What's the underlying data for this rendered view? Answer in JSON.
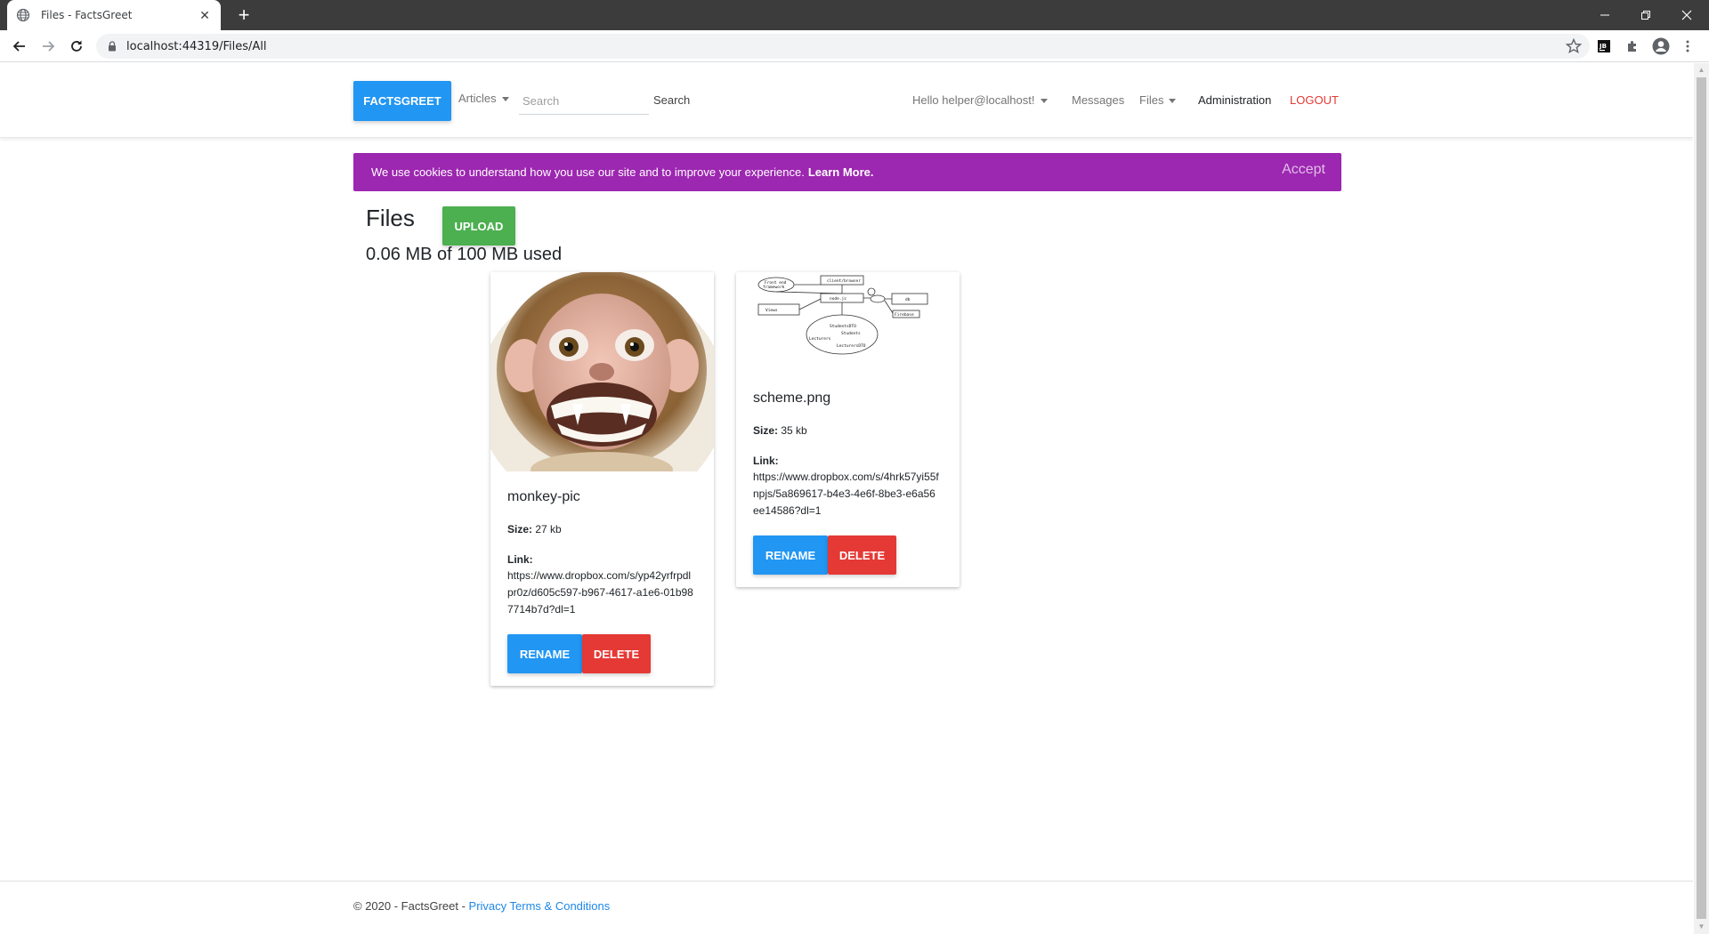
{
  "browser": {
    "tab_title": "Files - FactsGreet",
    "url": "localhost:44319/Files/All"
  },
  "header": {
    "brand": "FACTSGREET",
    "articles": "Articles",
    "search_placeholder": "Search",
    "search_button": "Search",
    "hello": "Hello helper@localhost!",
    "messages": "Messages",
    "files": "Files",
    "administration": "Administration",
    "logout": "LOGOUT"
  },
  "cookie": {
    "text": "We use cookies to understand how you use our site and to improve your experience.",
    "learn_more": "Learn More.",
    "accept": "Accept"
  },
  "main": {
    "title": "Files",
    "upload": "UPLOAD",
    "usage": "0.06 MB of 100 MB used",
    "files": [
      {
        "name": "monkey-pic",
        "size_label": "Size:",
        "size": "27 kb",
        "link_label": "Link:",
        "link": "https://www.dropbox.com/s/yp42yrfrpdlpr0z/d605c597-b967-4617-a1e6-01b987714b7d?dl=1",
        "rename": "RENAME",
        "delete": "DELETE"
      },
      {
        "name": "scheme.png",
        "size_label": "Size:",
        "size": "35 kb",
        "link_label": "Link:",
        "link": "https://www.dropbox.com/s/4hrk57yi55fnpjs/5a869617-b4e3-4e6f-8be3-e6a56ee14586?dl=1",
        "rename": "RENAME",
        "delete": "DELETE"
      }
    ],
    "scheme_labels": {
      "front": "Front end",
      "framework": "framework",
      "client": "client/browser",
      "node": "node.js",
      "views": "Views",
      "db": "db",
      "firebase": "Firebase",
      "studentsdto": "StudentsDTO",
      "students": "Students",
      "lecturers": "Lecturers",
      "lecturersdto": "LecturersDTO"
    }
  },
  "footer": {
    "copyright": "© 2020 - FactsGreet -",
    "privacy": "Privacy",
    "terms": "Terms & Conditions"
  },
  "colors": {
    "primary": "#2196f3",
    "danger": "#e53935",
    "success": "#4caf50",
    "cookie": "#9c27b0"
  }
}
